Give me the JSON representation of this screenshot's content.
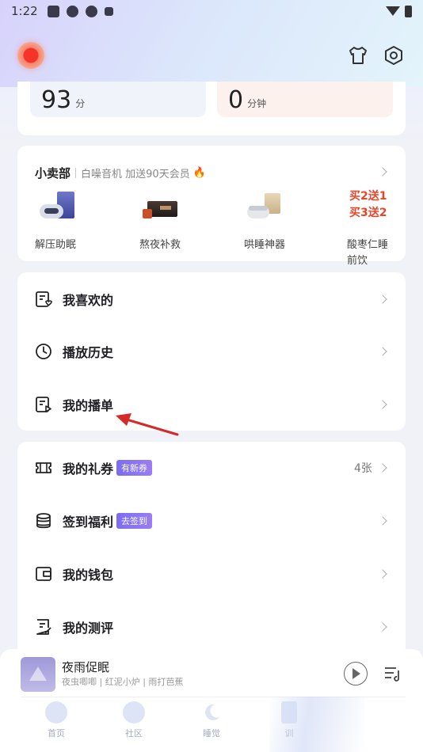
{
  "status_bar": {
    "time": "1:22"
  },
  "stats": {
    "left": {
      "value": "93",
      "unit": "分"
    },
    "right": {
      "value": "0",
      "unit": "分钟"
    }
  },
  "shop": {
    "title": "小卖部",
    "subtitle": "白噪音机 加送90天会员",
    "items": [
      {
        "name": "解压助眠"
      },
      {
        "name": "熬夜补救"
      },
      {
        "name": "哄睡神器"
      },
      {
        "name_line1": "酸枣仁睡",
        "name_line2": "前饮",
        "promo_line1": "买2送1",
        "promo_line2": "买3送2"
      }
    ]
  },
  "list1": [
    {
      "label": "我喜欢的",
      "icon": "favorite-list-icon"
    },
    {
      "label": "播放历史",
      "icon": "clock-icon"
    },
    {
      "label": "我的播单",
      "icon": "playlist-doc-icon"
    }
  ],
  "list2": [
    {
      "label": "我的礼券",
      "badge": "有新券",
      "count": "4张",
      "icon": "ticket-icon"
    },
    {
      "label": "签到福利",
      "badge": "去签到",
      "icon": "coins-icon"
    },
    {
      "label": "我的钱包",
      "icon": "wallet-icon"
    },
    {
      "label": "我的测评",
      "icon": "evaluation-icon"
    }
  ],
  "player": {
    "title": "夜雨促眠",
    "subtitle": "夜虫唧唧 | 红泥小炉 | 雨打芭蕉"
  },
  "tabs": [
    {
      "label": "首页",
      "icon": "home-icon"
    },
    {
      "label": "社区",
      "icon": "community-icon"
    },
    {
      "label": "睡觉",
      "icon": "moon-icon"
    },
    {
      "label": "训",
      "icon": "course-icon"
    }
  ],
  "colors": {
    "accent_badge": "#8a74f4",
    "promo": "#e8452a",
    "annotation_arrow": "#d42a2a"
  }
}
